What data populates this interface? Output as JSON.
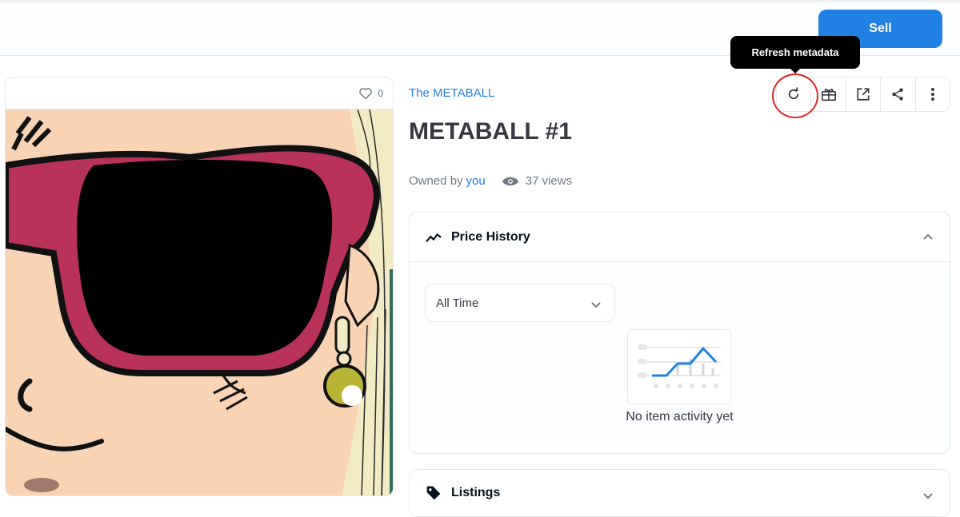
{
  "header": {
    "sell_label": "Sell"
  },
  "item": {
    "collection": "The METABALL",
    "name": "METABALL #1",
    "owned_by_label": "Owned by",
    "owner": "you",
    "views": "37 views",
    "favorites": "0"
  },
  "tooltip": {
    "text": "Refresh metadata"
  },
  "toolbar": {
    "icons": [
      "refresh-icon",
      "gift-icon",
      "external-link-icon",
      "share-icon",
      "more-vertical-icon"
    ]
  },
  "price_history": {
    "title": "Price History",
    "range_selected": "All Time",
    "empty_text": "No item activity yet"
  },
  "listings": {
    "title": "Listings"
  },
  "colors": {
    "accent": "#2081e2",
    "highlight_ring": "#e0261f",
    "glasses": "#b8325a"
  }
}
